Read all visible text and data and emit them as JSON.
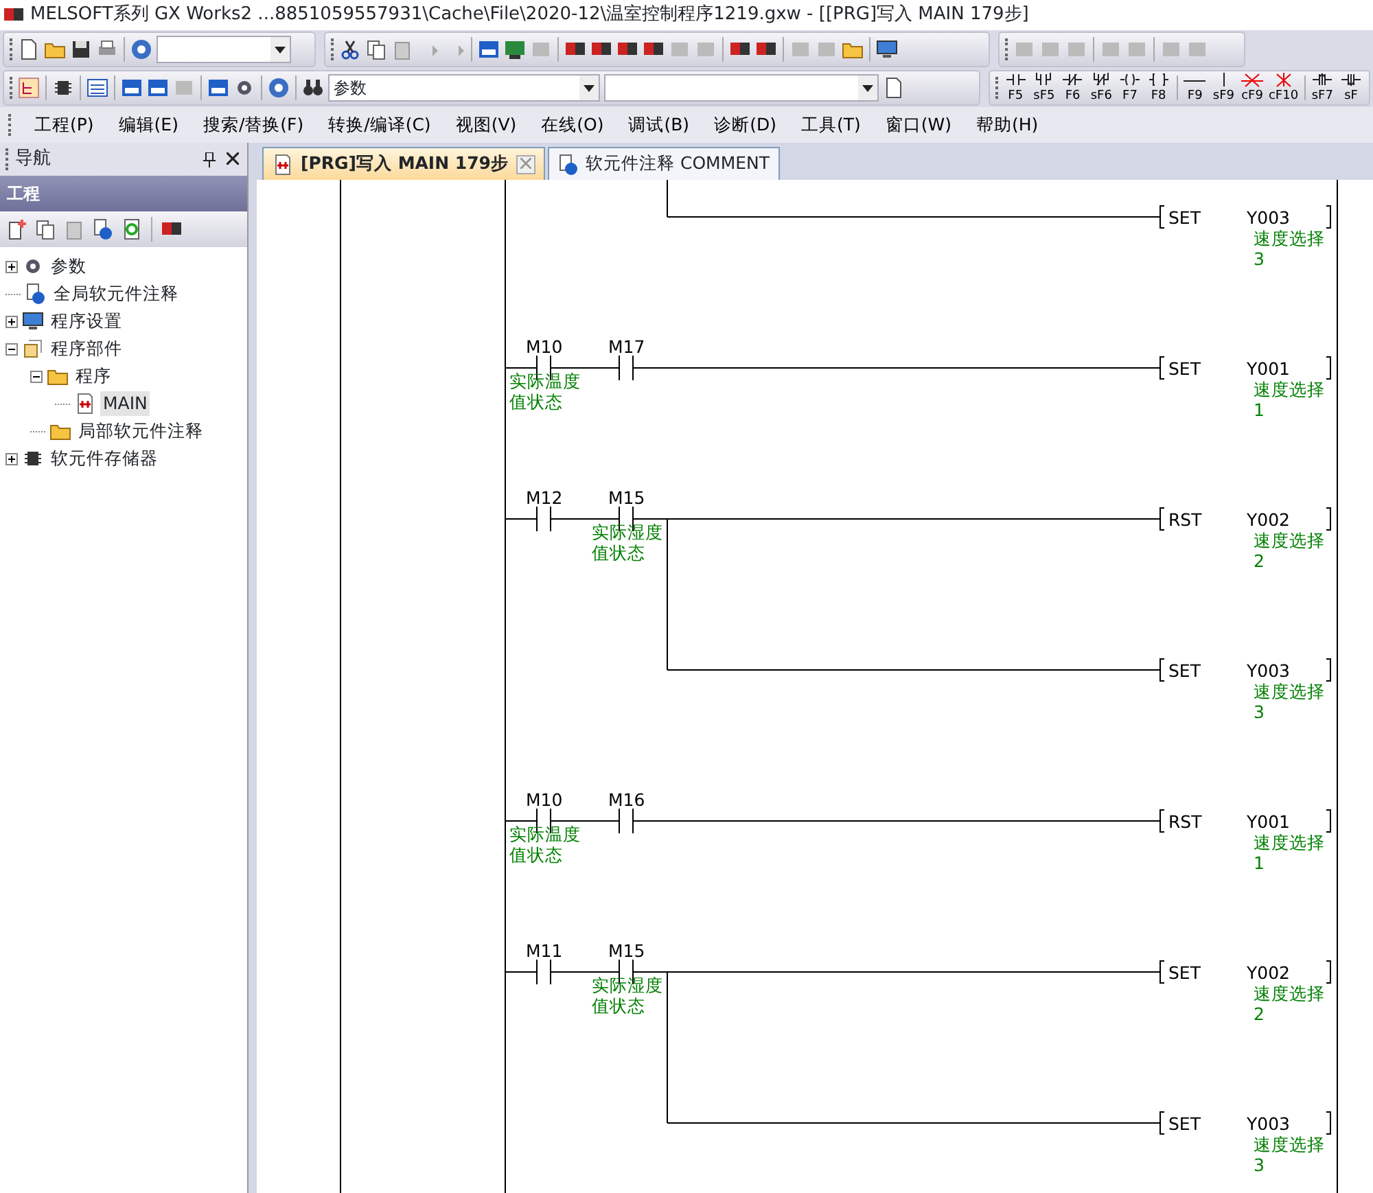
{
  "window": {
    "title": "MELSOFT系列 GX Works2 ...8851059557931\\Cache\\File\\2020-12\\温室控制程序1219.gxw - [[PRG]写入 MAIN 179步]"
  },
  "toolbar": {
    "data_type_combo": {
      "value": "参数"
    }
  },
  "ladder_keys": [
    {
      "label": "F5",
      "kind": "open"
    },
    {
      "label": "sF5",
      "kind": "open-branch"
    },
    {
      "label": "F6",
      "kind": "closed"
    },
    {
      "label": "sF6",
      "kind": "closed-branch"
    },
    {
      "label": "F7",
      "kind": "coil"
    },
    {
      "label": "F8",
      "kind": "function"
    },
    {
      "label": "F9",
      "kind": "hline"
    },
    {
      "label": "sF9",
      "kind": "vline"
    },
    {
      "label": "cF9",
      "kind": "delete-hline"
    },
    {
      "label": "cF10",
      "kind": "delete-vline"
    },
    {
      "label": "sF7",
      "kind": "rising"
    },
    {
      "label": "sF",
      "kind": "falling"
    }
  ],
  "menu": [
    "工程(P)",
    "编辑(E)",
    "搜索/替换(F)",
    "转换/编译(C)",
    "视图(V)",
    "在线(O)",
    "调试(B)",
    "诊断(D)",
    "工具(T)",
    "窗口(W)",
    "帮助(H)"
  ],
  "navigation": {
    "title": "导航",
    "section": "工程",
    "tree": [
      {
        "label": "参数",
        "expanded": false,
        "selected": false
      },
      {
        "label": "全局软元件注释",
        "selected": false
      },
      {
        "label": "程序设置",
        "expanded": false,
        "selected": false
      },
      {
        "label": "程序部件",
        "expanded": true,
        "selected": false,
        "children": [
          {
            "label": "程序",
            "expanded": true,
            "selected": false,
            "children": [
              {
                "label": "MAIN",
                "selected": true
              }
            ]
          },
          {
            "label": "局部软元件注释",
            "selected": false
          }
        ]
      },
      {
        "label": "软元件存储器",
        "expanded": false,
        "selected": false
      }
    ]
  },
  "tabs": [
    {
      "label": "[PRG]写入 MAIN 179步",
      "selected": true,
      "closable": true
    },
    {
      "label": "软元件注释 COMMENT",
      "selected": false,
      "closable": false
    }
  ],
  "ladder": {
    "rungs": [
      {
        "outputs": [
          {
            "instruction": "SET",
            "device": "Y003",
            "comment": [
              "速度选择",
              "3"
            ]
          }
        ]
      },
      {
        "contacts": [
          {
            "device": "M10",
            "comment": [
              "实际温度",
              "值状态"
            ]
          },
          {
            "device": "M17"
          }
        ],
        "outputs": [
          {
            "instruction": "SET",
            "device": "Y001",
            "comment": [
              "速度选择",
              "1"
            ]
          }
        ]
      },
      {
        "contacts": [
          {
            "device": "M12"
          },
          {
            "device": "M15",
            "comment": [
              "实际湿度",
              "值状态"
            ]
          }
        ],
        "outputs": [
          {
            "instruction": "RST",
            "device": "Y002",
            "comment": [
              "速度选择",
              "2"
            ]
          },
          {
            "instruction": "SET",
            "device": "Y003",
            "comment": [
              "速度选择",
              "3"
            ]
          }
        ]
      },
      {
        "contacts": [
          {
            "device": "M10",
            "comment": [
              "实际温度",
              "值状态"
            ]
          },
          {
            "device": "M16"
          }
        ],
        "outputs": [
          {
            "instruction": "RST",
            "device": "Y001",
            "comment": [
              "速度选择",
              "1"
            ]
          }
        ]
      },
      {
        "contacts": [
          {
            "device": "M11"
          },
          {
            "device": "M15",
            "comment": [
              "实际湿度",
              "值状态"
            ]
          }
        ],
        "outputs": [
          {
            "instruction": "SET",
            "device": "Y002",
            "comment": [
              "速度选择",
              "2"
            ]
          },
          {
            "instruction": "SET",
            "device": "Y003",
            "comment": [
              "速度选择",
              "3"
            ]
          }
        ]
      }
    ]
  }
}
